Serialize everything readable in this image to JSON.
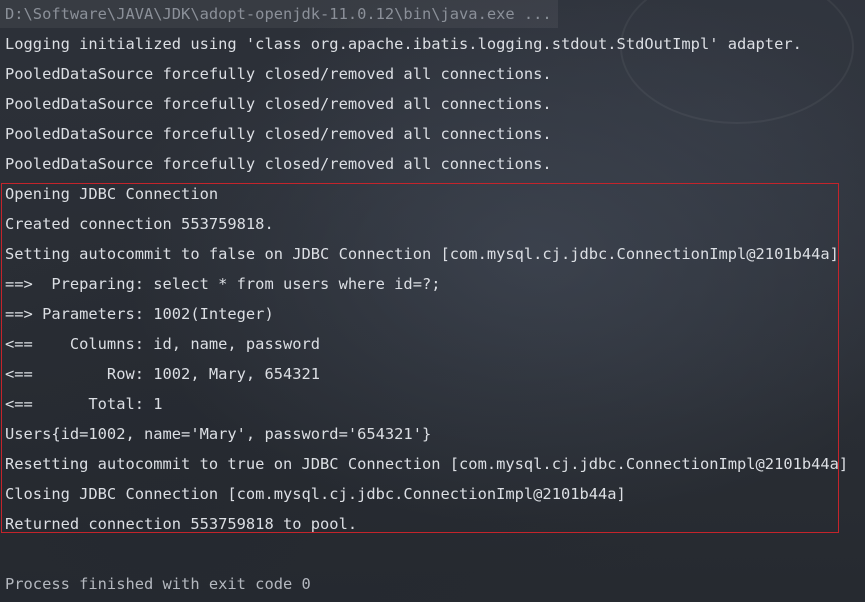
{
  "command": "D:\\Software\\JAVA\\JDK\\adopt-openjdk-11.0.12\\bin\\java.exe ...",
  "log_lines": [
    "Logging initialized using 'class org.apache.ibatis.logging.stdout.StdOutImpl' adapter.",
    "PooledDataSource forcefully closed/removed all connections.",
    "PooledDataSource forcefully closed/removed all connections.",
    "PooledDataSource forcefully closed/removed all connections.",
    "PooledDataSource forcefully closed/removed all connections.",
    "Opening JDBC Connection",
    "Created connection 553759818.",
    "Setting autocommit to false on JDBC Connection [com.mysql.cj.jdbc.ConnectionImpl@2101b44a]",
    "==>  Preparing: select * from users where id=?;",
    "==> Parameters: 1002(Integer)",
    "<==    Columns: id, name, password",
    "<==        Row: 1002, Mary, 654321",
    "<==      Total: 1",
    "Users{id=1002, name='Mary', password='654321'}",
    "Resetting autocommit to true on JDBC Connection [com.mysql.cj.jdbc.ConnectionImpl@2101b44a]",
    "Closing JDBC Connection [com.mysql.cj.jdbc.ConnectionImpl@2101b44a]",
    "Returned connection 553759818 to pool."
  ],
  "exit_message": "Process finished with exit code 0",
  "colors": {
    "text": "#dcdfe4",
    "highlight_border": "#c4242b",
    "background": "#2b2f36"
  }
}
